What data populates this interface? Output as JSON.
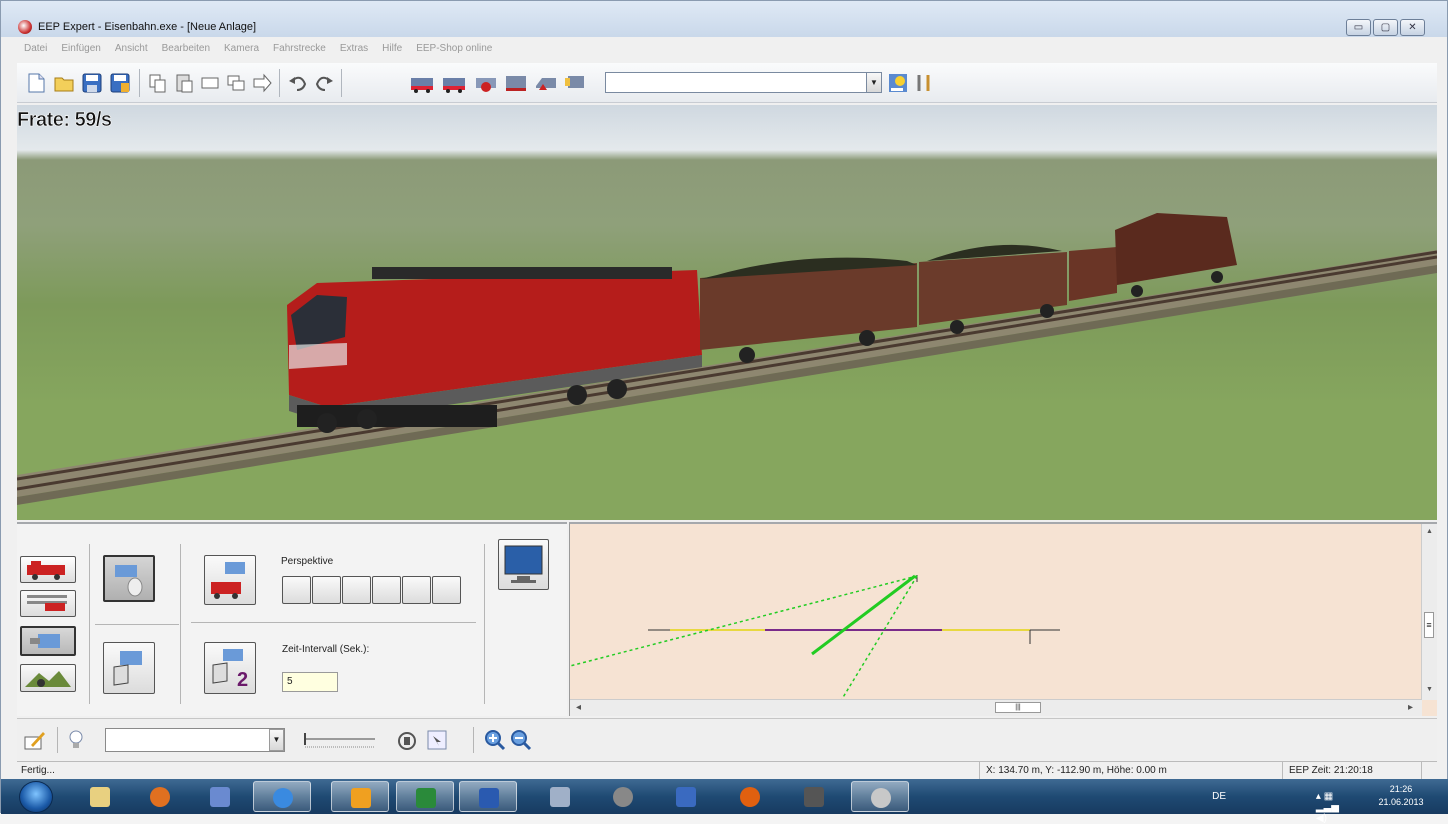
{
  "window": {
    "title": "EEP Expert - Eisenbahn.exe - [Neue Anlage]",
    "controls": [
      "▭",
      "▢",
      "✕"
    ]
  },
  "menu": [
    "Datei",
    "Einfügen",
    "Ansicht",
    "Bearbeiten",
    "Kamera",
    "Fahrstrecke",
    "Extras",
    "Hilfe",
    "EEP-Shop online"
  ],
  "toolbar": {
    "icons": [
      "new-file-icon",
      "open-folder-icon",
      "save-icon",
      "save-as-icon",
      "copy-icon",
      "paste-icon",
      "rectangle-icon",
      "duplicate-icon",
      "forward-icon",
      "undo-icon",
      "redo-icon",
      "train-icon-1",
      "train-icon-2",
      "train-icon-3",
      "train-icon-4",
      "train-icon-5",
      "train-icon-6",
      "weather-icon",
      "tools-icon"
    ],
    "combo_value": "",
    "combo_arrow": "▼"
  },
  "viewport": {
    "frate_label": "Frate: 59/s"
  },
  "control_panel": {
    "perspective_label": "Perspektive",
    "interval_label": "Zeit-Intervall (Sek.):",
    "interval_value": "5",
    "camera_number": "2"
  },
  "map": {
    "hscroll_grip": "|||",
    "vscroll_grip": "≡",
    "scroll_up": "▲",
    "scroll_down": "▼",
    "scroll_left": "◂",
    "scroll_right": "▸"
  },
  "tool_strip": {
    "combo_value": "",
    "combo_arrow": "▼"
  },
  "status": {
    "left": "Fertig...",
    "coords": "X: 134.70 m, Y: -112.90 m, Höhe: 0.00 m",
    "time": "EEP Zeit: 21:20:18"
  },
  "taskbar": {
    "lang": "DE",
    "time": "21:26",
    "date": "21.06.2013",
    "tray_icons": "▴ ▦ ▂▃▅ ◀)"
  },
  "colors": {
    "titlebar": "#c9d8ea",
    "map_bg": "#f6e3d3",
    "taskbar": "#1f4a73",
    "track_green": "#22cc22",
    "track_yellow": "#e8d840",
    "track_purple": "#7a2a8a"
  }
}
